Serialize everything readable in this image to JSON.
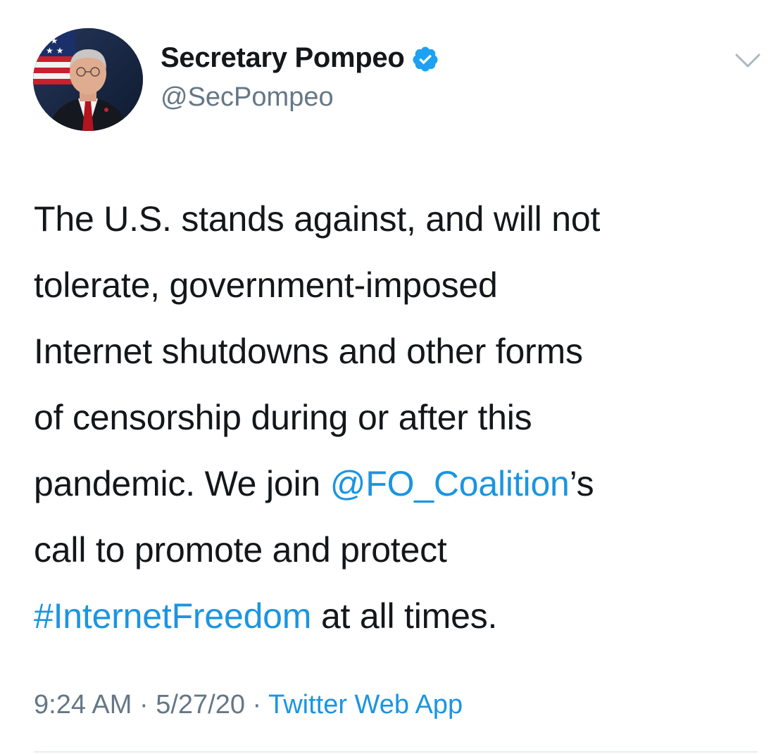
{
  "author": {
    "display_name": "Secretary Pompeo",
    "handle": "@SecPompeo",
    "verified_icon": "verified-badge-icon",
    "accent_color": "#1DA1F2"
  },
  "tweet": {
    "lines": [
      [
        {
          "text": "The U.S. stands against, and will not",
          "link": false
        }
      ],
      [
        {
          "text": "tolerate, government-imposed",
          "link": false
        }
      ],
      [
        {
          "text": "Internet shutdowns and other forms",
          "link": false
        }
      ],
      [
        {
          "text": "of censorship during or after this",
          "link": false
        }
      ],
      [
        {
          "text": "pandemic. We join ",
          "link": false
        },
        {
          "text": "@FO_Coalition",
          "link": true
        },
        {
          "text": "’s",
          "link": false
        }
      ],
      [
        {
          "text": "call to promote and protect",
          "link": false
        }
      ],
      [
        {
          "text": "#InternetFreedom",
          "link": true
        },
        {
          "text": " at all times.",
          "link": false
        }
      ]
    ]
  },
  "meta": {
    "time": "9:24 AM",
    "separator": " · ",
    "date": "5/27/20",
    "source": "Twitter Web App"
  },
  "colors": {
    "link": "#1B95E0",
    "secondary_text": "#657786",
    "primary_text": "#14171A"
  }
}
